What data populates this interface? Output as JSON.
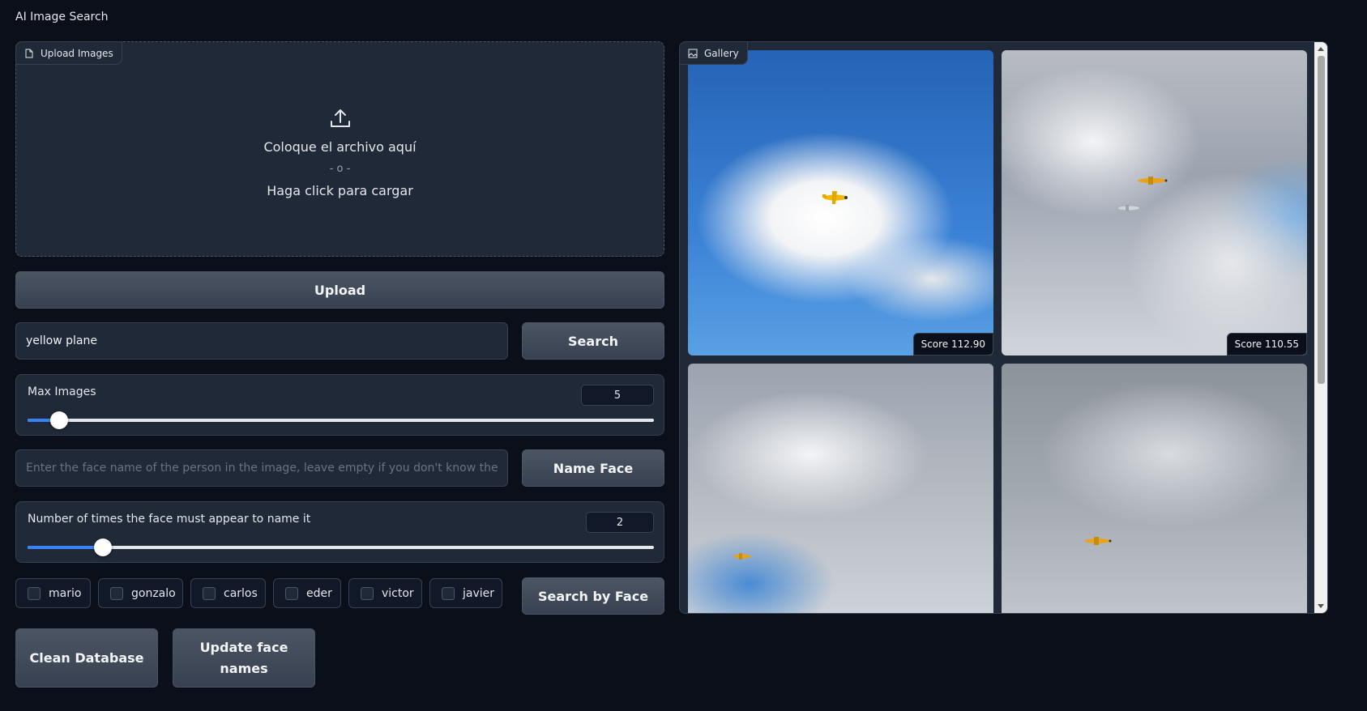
{
  "app": {
    "title": "AI Image Search"
  },
  "upload": {
    "label": "Upload Images",
    "drop_text": "Coloque el archivo aquí",
    "or_text": "- o -",
    "click_text": "Haga click para cargar",
    "button_label": "Upload"
  },
  "search": {
    "value": "yellow plane",
    "button_label": "Search"
  },
  "max_images": {
    "label": "Max Images",
    "value": "5",
    "fraction": 0.05
  },
  "face_name": {
    "placeholder": "Enter the face name of the person in the image, leave empty if you don't know the person",
    "button_label": "Name Face"
  },
  "face_count": {
    "label": "Number of times the face must appear to name it",
    "value": "2",
    "fraction": 0.12
  },
  "faces": [
    "mario",
    "gonzalo",
    "carlos",
    "eder",
    "victor",
    "javier"
  ],
  "face_search_button": "Search by Face",
  "actions": {
    "clean_label": "Clean Database",
    "update_label": "Update face names"
  },
  "gallery": {
    "label": "Gallery",
    "items": [
      {
        "score": "Score 112.90"
      },
      {
        "score": "Score 110.55"
      },
      {
        "score": ""
      },
      {
        "score": ""
      }
    ]
  },
  "colors": {
    "accent": "#3b82f6",
    "background": "#0b0f19",
    "panel": "#1f2937"
  }
}
